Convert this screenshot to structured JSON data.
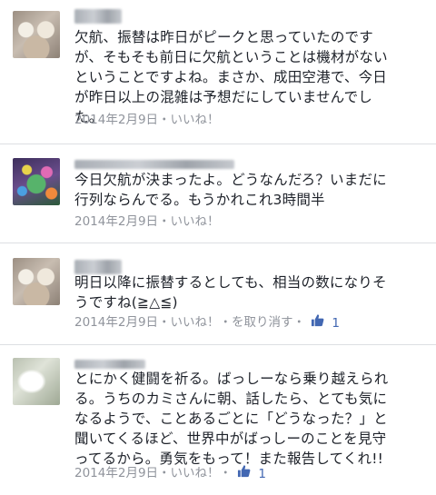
{
  "comments": [
    {
      "avatar": "dog-photo",
      "lines": [
        "欠航、振替は昨日がピークと思っていたのです",
        "が、そもそも前日に欠航ということは機材がない",
        "ということですよね。まさか、成田空港で、今日",
        "が昨日以上の混雑は予想だにしていませんでし",
        "た。"
      ],
      "date": "2014年2月9日",
      "sep1": "・",
      "like": "いいね！"
    },
    {
      "avatar": "party-photo",
      "lines": [
        "今日欠航が決まったよ。どうなんだろ？いまだに",
        "行列ならんでる。もうかれこれ3時間半"
      ],
      "date": "2014年2月9日",
      "sep1": "・",
      "like": "いいね！"
    },
    {
      "avatar": "dog-photo",
      "lines": [
        "明日以降に振替するとしても、相当の数になりそ",
        "うですね(≧△≦)"
      ],
      "date": "2014年2月9日",
      "sep1": "・",
      "like": "いいね！",
      "sep2": "・",
      "unlike": "を取り消す",
      "sep3": "・",
      "like_count": "1"
    },
    {
      "avatar": "pale-photo",
      "lines": [
        "とにかく健闘を祈る。ばっしーなら乗り越えられ",
        "る。うちのカミさんに朝、話したら、とても気に",
        "なるようで、ことあるごとに「どうなった？」と",
        "聞いてくるほど、世界中がばっしーのことを見守",
        "ってるから。勇気をもって！また報告してくれ!!"
      ],
      "date": "2014年2月9日",
      "sep1": "・",
      "like": "いいね！",
      "sep2": "・",
      "like_count": "1"
    }
  ],
  "colors": {
    "text": "#1d2129",
    "meta": "#90949c",
    "like_blue": "#4267b2",
    "divider": "#dddfe2"
  }
}
